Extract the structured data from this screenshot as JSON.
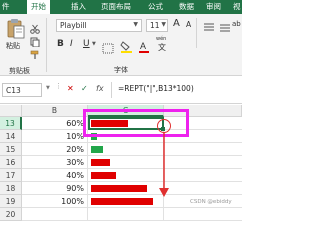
{
  "ribbon_tabs": [
    "件",
    "开始",
    "插入",
    "页面布局",
    "公式",
    "数据",
    "审阅",
    "视"
  ],
  "active_tab_index": 1,
  "clipboard": {
    "paste_label": "粘贴",
    "group_label": "剪贴板"
  },
  "font": {
    "family_value": "Playbill",
    "size_value": "11",
    "grow_label": "A",
    "shrink_label": "A",
    "bold_label": "B",
    "italic_label": "I",
    "underline_label": "U",
    "wen_label": "wén",
    "group_label": "字体"
  },
  "alignment": {
    "ab_label": "ab"
  },
  "formula_bar": {
    "name_box": "C13",
    "fx_label": "fx",
    "formula": "=REPT(\"|\",B13*100)"
  },
  "columns": {
    "b": "B",
    "c": "C"
  },
  "rows": [
    {
      "num": "13",
      "value": "60%",
      "level": 0.6,
      "color": "#e00000",
      "selected": true
    },
    {
      "num": "14",
      "value": "10%",
      "level": 0.1,
      "color": "#21a64a",
      "selected": false
    },
    {
      "num": "15",
      "value": "20%",
      "level": 0.2,
      "color": "#21a64a",
      "selected": false
    },
    {
      "num": "16",
      "value": "30%",
      "level": 0.3,
      "color": "#e00000",
      "selected": false
    },
    {
      "num": "17",
      "value": "40%",
      "level": 0.4,
      "color": "#e00000",
      "selected": false
    },
    {
      "num": "18",
      "value": "90%",
      "level": 0.9,
      "color": "#e00000",
      "selected": false
    },
    {
      "num": "19",
      "value": "100%",
      "level": 1.0,
      "color": "#e00000",
      "selected": false
    },
    {
      "num": "20",
      "value": "",
      "level": 0,
      "color": "",
      "selected": false
    }
  ],
  "annotation_color": "#ee22ee",
  "arrow_color": "#e03030",
  "watermark": "CSDN @ebiddy"
}
